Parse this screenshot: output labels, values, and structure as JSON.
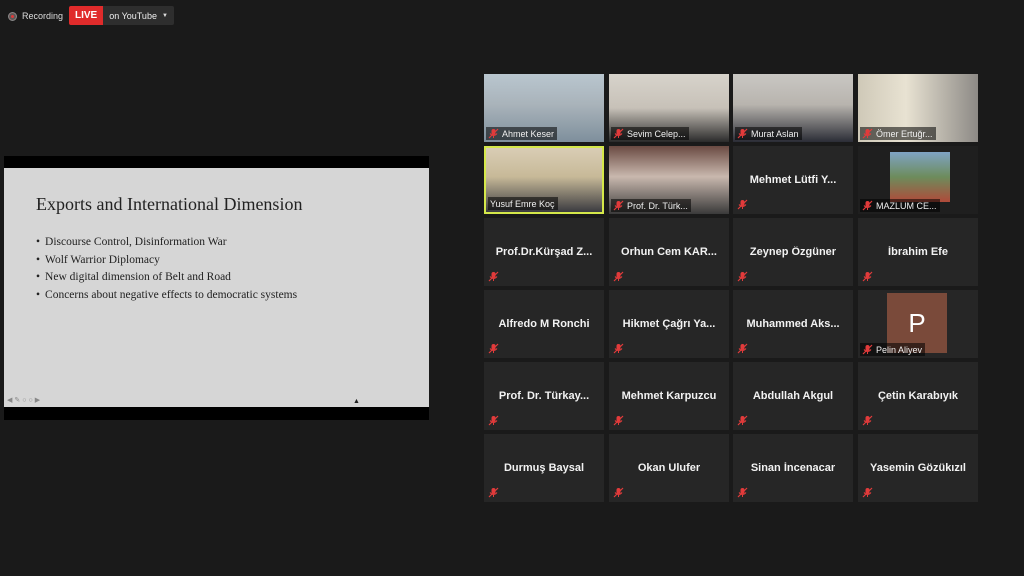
{
  "recording": {
    "label": "Recording"
  },
  "live": {
    "badge": "LIVE",
    "destination": "on YouTube"
  },
  "slide": {
    "title": "Exports and International Dimension",
    "bullets": [
      "Discourse Control, Disinformation War",
      "Wolf  Warrior Diplomacy",
      "New digital dimension of Belt and Road",
      "Concerns about negative effects to democratic systems"
    ]
  },
  "participants": [
    {
      "name": "Ahmet Keser",
      "video": true,
      "muted": true
    },
    {
      "name": "Sevim Celep...",
      "video": true,
      "muted": true
    },
    {
      "name": "Murat Aslan",
      "video": true,
      "muted": true
    },
    {
      "name": "Ömer Ertuğr...",
      "video": true,
      "muted": true
    },
    {
      "name": "Yusuf Emre Koç",
      "video": true,
      "muted": false,
      "speaking": true
    },
    {
      "name": "Prof. Dr. Türk...",
      "video": true,
      "muted": true
    },
    {
      "name": "Mehmet  Lütfi  Y...",
      "video": false,
      "muted": true
    },
    {
      "name": "MAZLUM CE...",
      "video": true,
      "muted": true
    },
    {
      "name": "Prof.Dr.Kürşad  Z...",
      "video": false,
      "muted": true
    },
    {
      "name": "Orhun  Cem  KAR...",
      "video": false,
      "muted": true
    },
    {
      "name": "Zeynep Özgüner",
      "video": false,
      "muted": true
    },
    {
      "name": "İbrahim Efe",
      "video": false,
      "muted": true
    },
    {
      "name": "Alfredo M Ronchi",
      "video": false,
      "muted": true
    },
    {
      "name": "Hikmet  Çağrı  Ya...",
      "video": false,
      "muted": true
    },
    {
      "name": "Muhammed  Aks...",
      "video": false,
      "muted": true
    },
    {
      "name": "Pelin Aliyev",
      "video": false,
      "muted": true,
      "avatar": "P"
    },
    {
      "name": "Prof.  Dr.  Türkay...",
      "video": false,
      "muted": true
    },
    {
      "name": "Mehmet Karpuzcu",
      "video": false,
      "muted": true
    },
    {
      "name": "Abdullah Akgul",
      "video": false,
      "muted": true
    },
    {
      "name": "Çetin Karabıyık",
      "video": false,
      "muted": true
    },
    {
      "name": "Durmuş Baysal",
      "video": false,
      "muted": true
    },
    {
      "name": "Okan Ulufer",
      "video": false,
      "muted": true
    },
    {
      "name": "Sinan İncenacar",
      "video": false,
      "muted": true
    },
    {
      "name": "Yasemin Gözükızıl",
      "video": false,
      "muted": true
    }
  ],
  "colors": {
    "live": "#e02b2b",
    "speaking_border": "#d5e84a",
    "muted_icon": "#e23b3b"
  }
}
